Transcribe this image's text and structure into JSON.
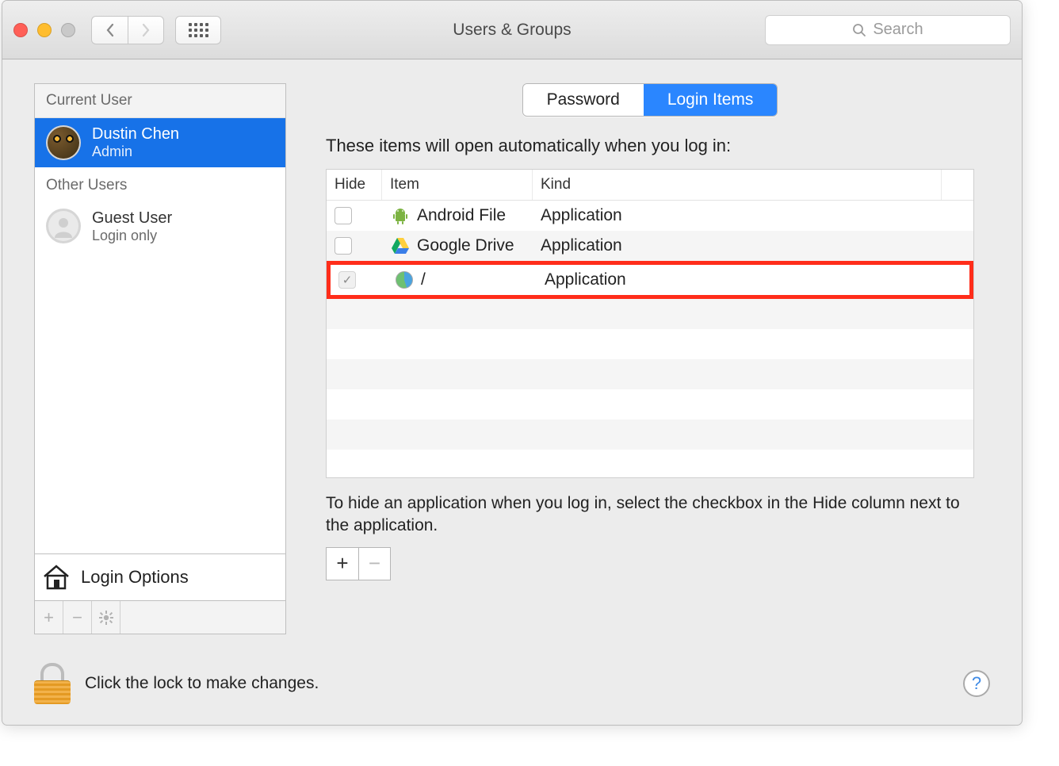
{
  "window": {
    "title": "Users & Groups"
  },
  "search": {
    "placeholder": "Search"
  },
  "sidebar": {
    "current_header": "Current User",
    "other_header": "Other Users",
    "current_user": {
      "name": "Dustin Chen",
      "role": "Admin"
    },
    "other_user": {
      "name": "Guest User",
      "role": "Login only"
    },
    "login_options_label": "Login Options"
  },
  "tabs": {
    "password": "Password",
    "login_items": "Login Items"
  },
  "main": {
    "description": "These items will open automatically when you log in:",
    "columns": {
      "hide": "Hide",
      "item": "Item",
      "kind": "Kind"
    },
    "items": [
      {
        "name": "Android File",
        "kind": "Application",
        "hidden": false
      },
      {
        "name": "Google Drive",
        "kind": "Application",
        "hidden": false
      },
      {
        "name": "/",
        "kind": "Application",
        "hidden": true,
        "highlighted": true
      }
    ],
    "hint": "To hide an application when you log in, select the checkbox in the Hide column next to the application."
  },
  "footer": {
    "lock_text": "Click the lock to make changes."
  }
}
